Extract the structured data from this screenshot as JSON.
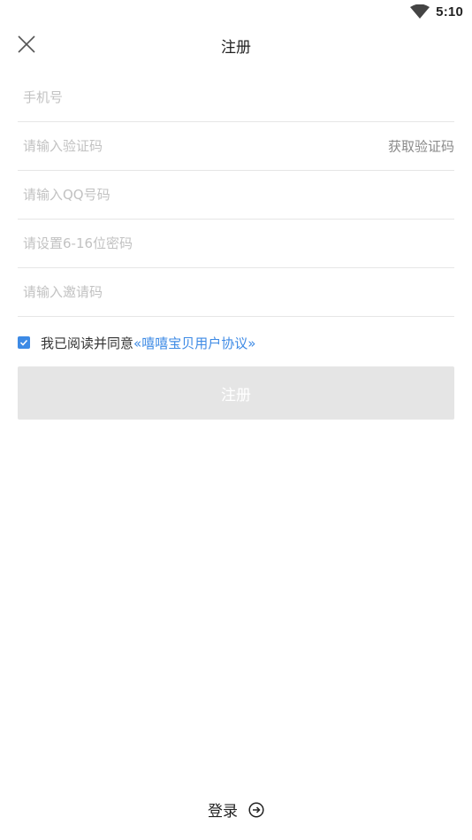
{
  "status_bar": {
    "time": "5:10",
    "wifi_icon": "wifi-icon"
  },
  "header": {
    "title": "注册",
    "close_icon": "close-icon"
  },
  "form": {
    "phone_placeholder": "手机号",
    "code_placeholder": "请输入验证码",
    "get_code_label": "获取验证码",
    "qq_placeholder": "请输入QQ号码",
    "password_placeholder": "请设置6-16位密码",
    "invite_placeholder": "请输入邀请码"
  },
  "agreement": {
    "checked": true,
    "text": "我已阅读并同意",
    "link_text": "«嘻嘻宝贝用户协议»"
  },
  "register_button": {
    "label": "注册"
  },
  "footer": {
    "login_label": "登录",
    "arrow_icon": "arrow-right-circle-icon"
  },
  "colors": {
    "accent": "#3d8ae5",
    "button_disabled": "#e5e5e5",
    "placeholder": "#c2c2c2",
    "divider": "#e6e6e6"
  }
}
